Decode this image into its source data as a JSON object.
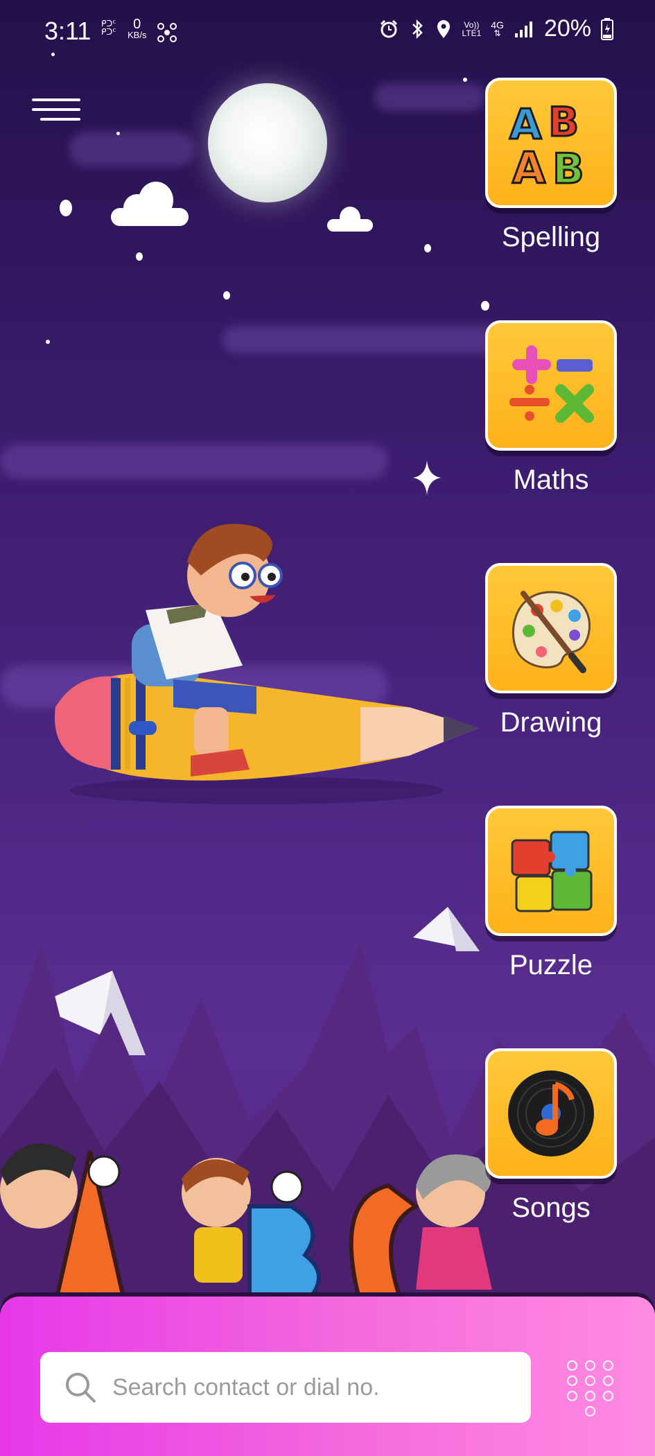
{
  "status_bar": {
    "time": "3:11",
    "net_label_top": "ᑭᑐᑦ",
    "net_label_bottom": "ᑭᑐᑦ",
    "speed_value": "0",
    "speed_unit": "KB/s",
    "volte_top": "Vo))",
    "volte_bottom": "LTE1",
    "network_type": "4G",
    "battery": "20%"
  },
  "categories": [
    {
      "label": "Spelling",
      "icon": "abc-letters-icon"
    },
    {
      "label": "Maths",
      "icon": "math-symbols-icon"
    },
    {
      "label": "Drawing",
      "icon": "paint-palette-icon"
    },
    {
      "label": "Puzzle",
      "icon": "puzzle-pieces-icon"
    },
    {
      "label": "Songs",
      "icon": "music-record-icon"
    }
  ],
  "search": {
    "placeholder": "Search contact or dial no."
  },
  "colors": {
    "tile": "#ffb21a",
    "bottom_start": "#e638e9",
    "bottom_end": "#ff8be2",
    "background": "#4b2582"
  }
}
